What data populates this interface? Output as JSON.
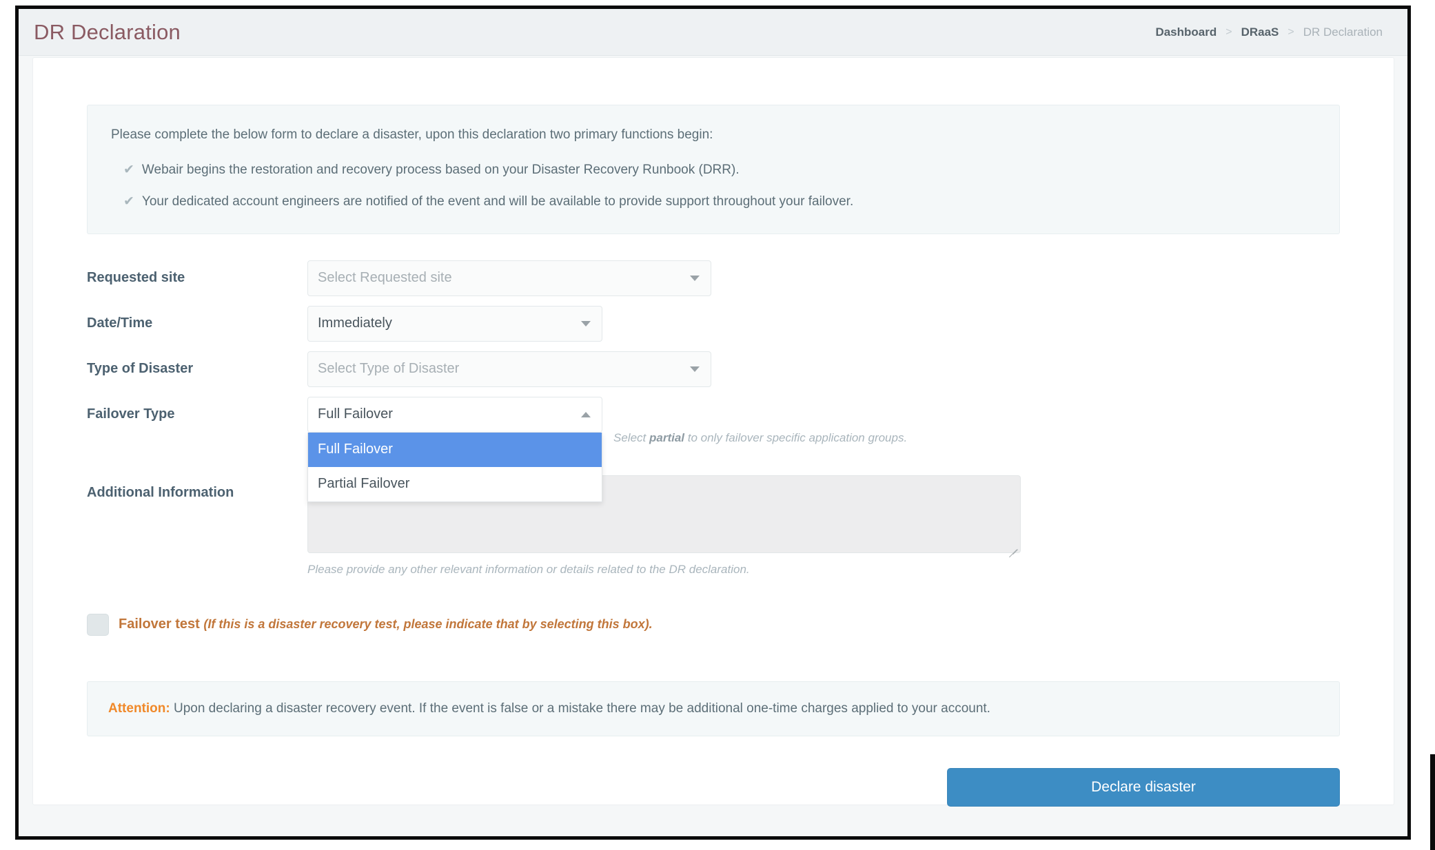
{
  "header": {
    "title": "DR Declaration",
    "breadcrumb": [
      {
        "label": "Dashboard",
        "current": false
      },
      {
        "label": "DRaaS",
        "current": false
      },
      {
        "label": "DR Declaration",
        "current": true
      }
    ],
    "separator": ">"
  },
  "info_panel": {
    "lead": "Please complete the below form to declare a disaster, upon this declaration two primary functions begin:",
    "items": [
      "Webair begins the restoration and recovery process based on your Disaster Recovery Runbook (DRR).",
      "Your dedicated account engineers are notified of the event and will be available to provide support throughout your failover."
    ],
    "check_icon": "✔"
  },
  "form": {
    "requested_site": {
      "label": "Requested site",
      "placeholder": "Select Requested site",
      "value": ""
    },
    "date_time": {
      "label": "Date/Time",
      "value": "Immediately"
    },
    "type_of_disaster": {
      "label": "Type of Disaster",
      "placeholder": "Select Type of Disaster",
      "value": ""
    },
    "failover_type": {
      "label": "Failover Type",
      "value": "Full Failover",
      "expanded": true,
      "options": [
        {
          "label": "Full Failover",
          "selected": true
        },
        {
          "label": "Partial Failover",
          "selected": false
        }
      ],
      "helper_prefix": "Select ",
      "helper_bold": "partial",
      "helper_suffix": " to only failover specific application groups."
    },
    "additional_information": {
      "label": "Additional Information",
      "value": "",
      "placeholder": "",
      "helper": "Please provide any other relevant information or details related to the DR declaration."
    },
    "failover_test": {
      "label": "Failover test",
      "note": "(If this is a disaster recovery test, please indicate that by selecting this box).",
      "checked": false
    }
  },
  "attention": {
    "word": "Attention:",
    "text": " Upon declaring a disaster recovery event. If the event is false or a mistake there may be additional one-time charges applied to your account."
  },
  "submit": {
    "label": "Declare disaster"
  },
  "colors": {
    "title": "#8a5a62",
    "accent_blue": "#3d8dc4",
    "dropdown_highlight": "#5b93e8",
    "attention_orange": "#f0892a",
    "failover_test_orange": "#c1763a"
  }
}
